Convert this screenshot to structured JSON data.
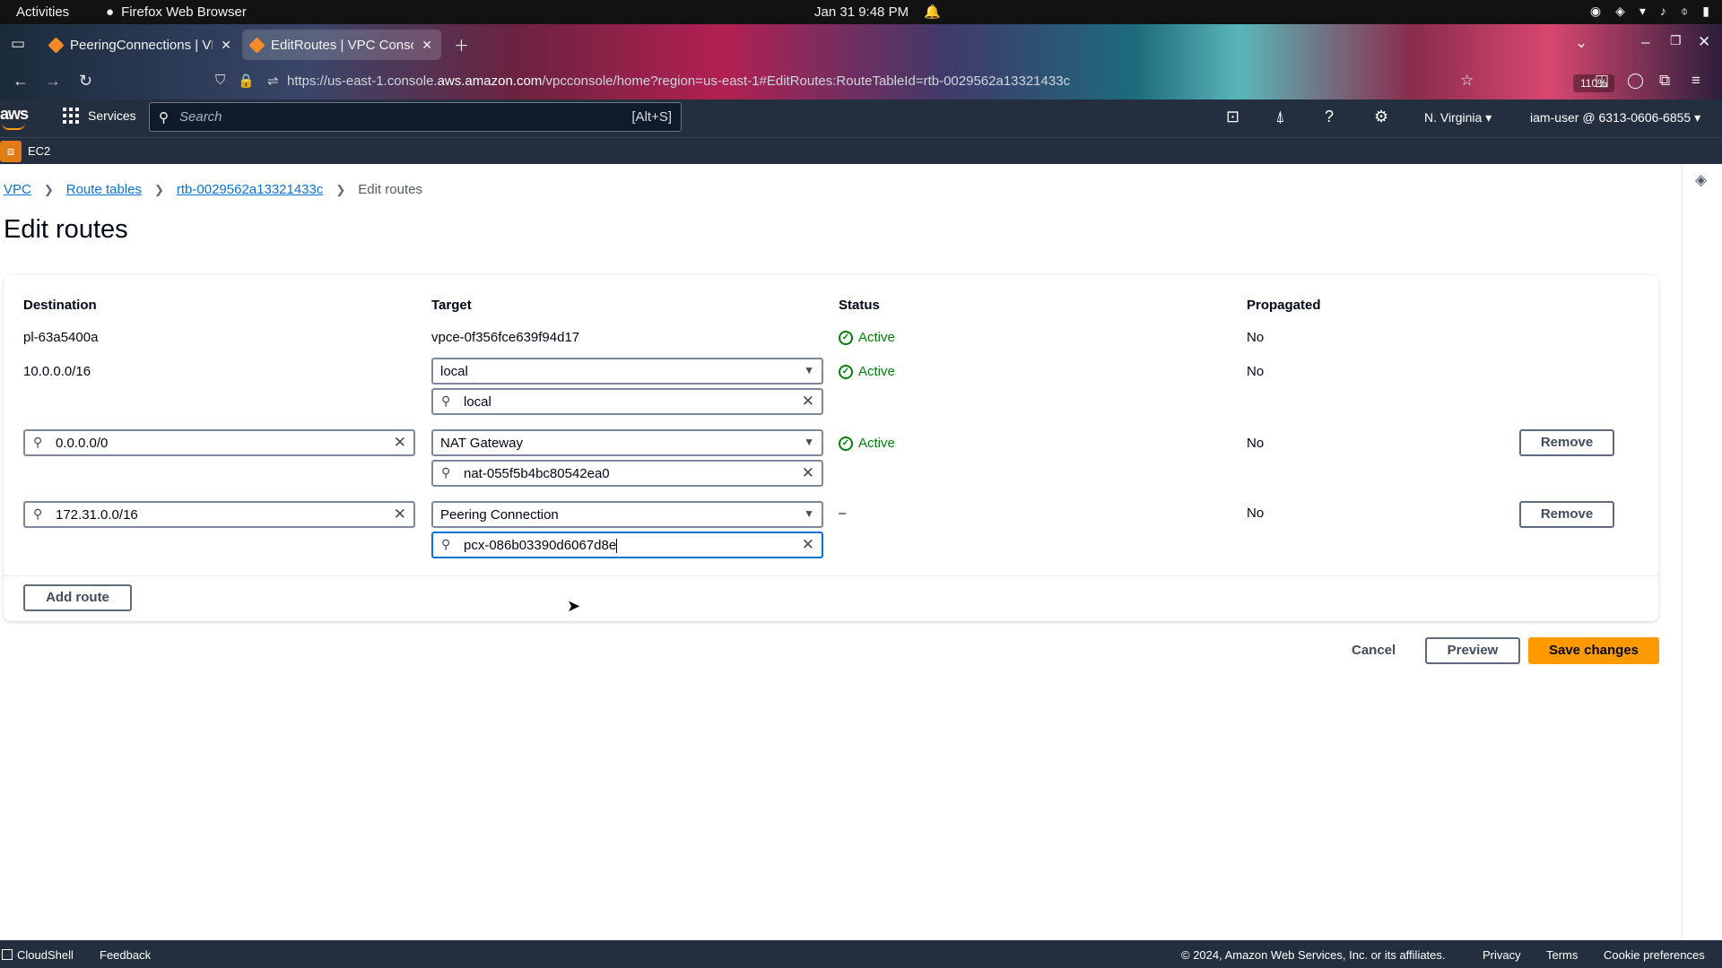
{
  "os": {
    "activities": "Activities",
    "app_name": "Firefox Web Browser",
    "clock": "Jan 31  9:48 PM"
  },
  "browser": {
    "tabs": [
      {
        "title": "PeeringConnections | VPC Console"
      },
      {
        "title": "EditRoutes | VPC Console"
      }
    ],
    "url_prefix": "https://us-east-1.console.",
    "url_domain": "aws.amazon.com",
    "url_path": "/vpcconsole/home?region=us-east-1#EditRoutes:RouteTableId=rtb-0029562a13321433c",
    "zoom": "110%"
  },
  "aws_header": {
    "logo": "aws",
    "services": "Services",
    "search_placeholder": "Search",
    "search_shortcut": "[Alt+S]",
    "region": "N. Virginia",
    "user": "iam-user @ 6313-0606-6855",
    "service_badge": "EC2"
  },
  "breadcrumb": {
    "vpc": "VPC",
    "route_tables": "Route tables",
    "route_table_id": "rtb-0029562a13321433c",
    "current": "Edit routes"
  },
  "page_title": "Edit routes",
  "table": {
    "headers": {
      "destination": "Destination",
      "target": "Target",
      "status": "Status",
      "propagated": "Propagated"
    },
    "rows": [
      {
        "destination": "pl-63a5400a",
        "target": "vpce-0f356fce639f94d17",
        "status": "Active",
        "propagated": "No"
      },
      {
        "destination": "10.0.0.0/16",
        "target_type": "local",
        "target_value": "local",
        "status": "Active",
        "propagated": "No"
      },
      {
        "destination": "0.0.0.0/0",
        "target_type": "NAT Gateway",
        "target_value": "nat-055f5b4bc80542ea0",
        "status": "Active",
        "propagated": "No",
        "remove_label": "Remove"
      },
      {
        "destination": "172.31.0.0/16",
        "target_type": "Peering Connection",
        "target_value": "pcx-086b03390d6067d8e",
        "status": "–",
        "propagated": "No",
        "remove_label": "Remove"
      }
    ],
    "add_route": "Add route"
  },
  "actions": {
    "cancel": "Cancel",
    "preview": "Preview",
    "save": "Save changes"
  },
  "footer": {
    "cloudshell": "CloudShell",
    "feedback": "Feedback",
    "copyright": "© 2024, Amazon Web Services, Inc. or its affiliates.",
    "privacy": "Privacy",
    "terms": "Terms",
    "cookies": "Cookie preferences"
  },
  "colors": {
    "accent": "#ff9900",
    "link": "#0972d3",
    "success": "#037f0c",
    "nav_bg": "#232f3e"
  }
}
